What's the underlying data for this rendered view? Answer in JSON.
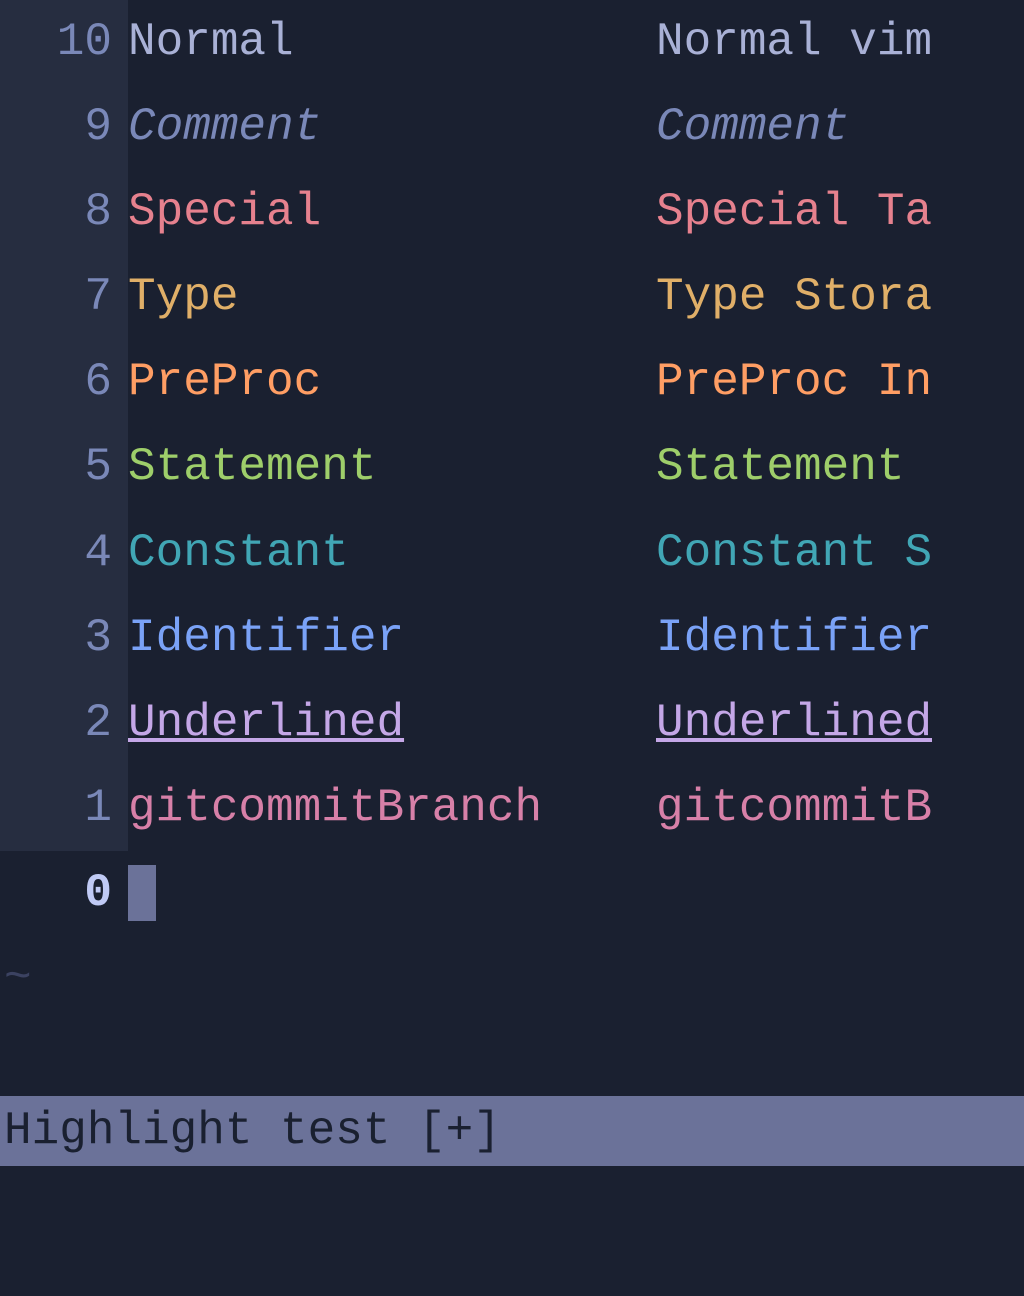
{
  "gutter": {
    "lines": [
      "10",
      "9",
      "8",
      "7",
      "6",
      "5",
      "4",
      "3",
      "2",
      "1",
      "0"
    ]
  },
  "rows": [
    {
      "col1": "Normal",
      "col2": "Normal vim",
      "style": "normal"
    },
    {
      "col1": "Comment",
      "col2": "Comment",
      "style": "comment"
    },
    {
      "col1": "Special",
      "col2": "Special Ta",
      "style": "special"
    },
    {
      "col1": "Type",
      "col2": "Type Stora",
      "style": "type"
    },
    {
      "col1": "PreProc",
      "col2": "PreProc In",
      "style": "preproc"
    },
    {
      "col1": "Statement",
      "col2": "Statement ",
      "style": "statement"
    },
    {
      "col1": "Constant",
      "col2": "Constant S",
      "style": "constant"
    },
    {
      "col1": "Identifier",
      "col2": "Identifier",
      "style": "identifier"
    },
    {
      "col1": "Underlined",
      "col2": "Underlined",
      "style": "underlined"
    },
    {
      "col1": "gitcommitBranch",
      "col2": "gitcommitB",
      "style": "gitcommit"
    }
  ],
  "tilde": "~",
  "statusline": "Highlight test [+]",
  "colors": {
    "background": "#1a2030",
    "normal": "#a9b1d6",
    "comment": "#7a88b8",
    "special": "#e6818e",
    "type": "#e0af68",
    "preproc": "#ff9e64",
    "statement": "#73daca",
    "constant": "#2ac3de",
    "identifier": "#7aa2f7",
    "underlined": "#c4a7e7",
    "gitcommit": "#d780a8",
    "statusbg": "#6b7299"
  }
}
